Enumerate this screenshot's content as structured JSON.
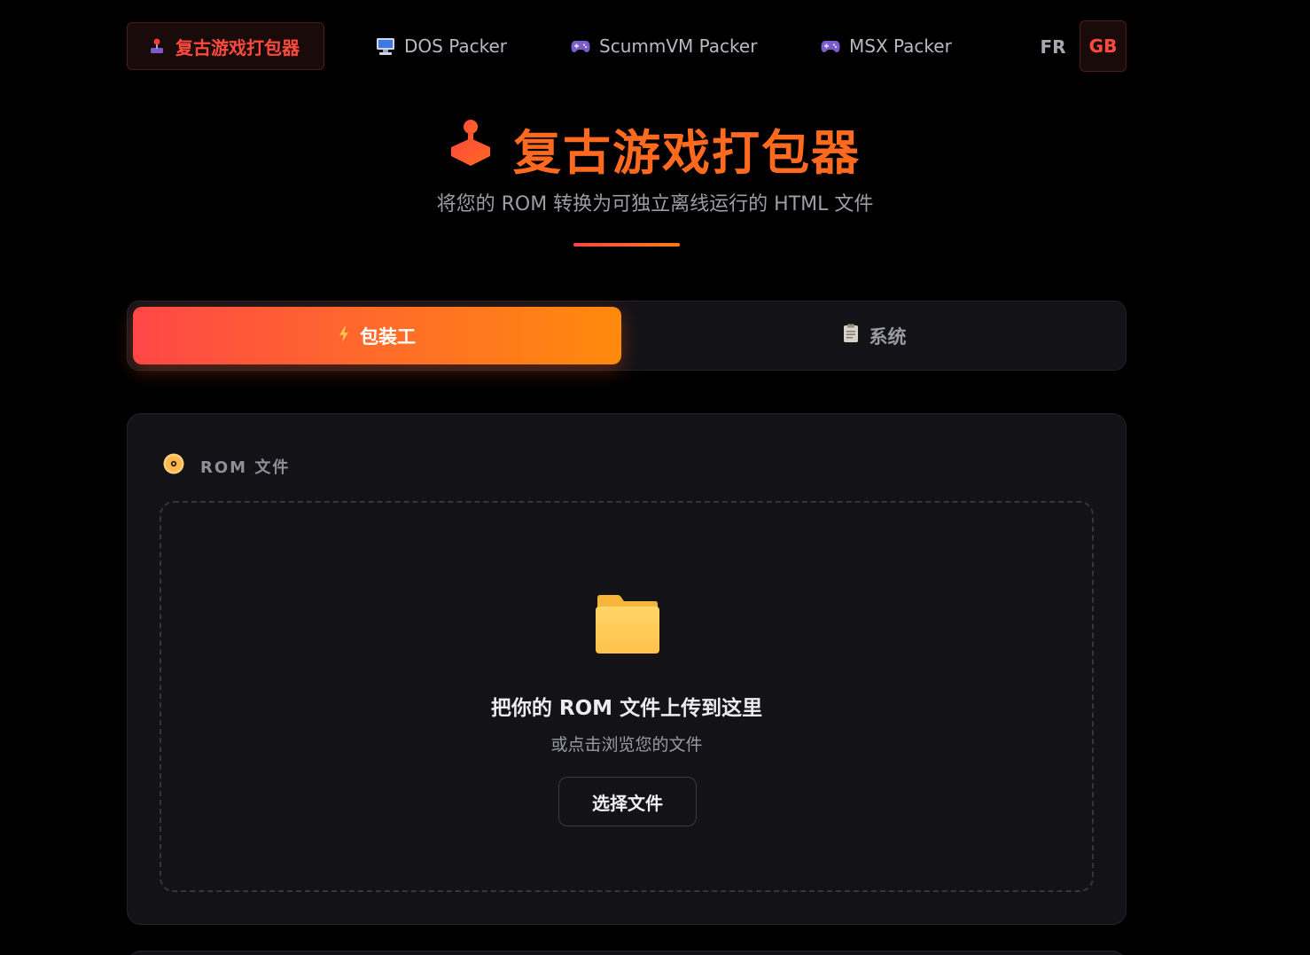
{
  "nav": {
    "items": [
      {
        "label": "复古游戏打包器",
        "icon": "joystick-icon",
        "active": true
      },
      {
        "label": "DOS Packer",
        "icon": "computer-icon",
        "active": false
      },
      {
        "label": "ScummVM Packer",
        "icon": "gamepad-icon",
        "active": false
      },
      {
        "label": "MSX Packer",
        "icon": "gamepad-icon",
        "active": false
      }
    ],
    "lang_fr": "FR",
    "lang_gb": "GB",
    "active_lang": "GB"
  },
  "header": {
    "title": "复古游戏打包器",
    "subtitle": "将您的 ROM 转换为可独立离线运行的 HTML 文件"
  },
  "tabs": [
    {
      "label": "包装工",
      "icon": "lightning-icon",
      "active": true
    },
    {
      "label": "系统",
      "icon": "clipboard-icon",
      "active": false
    }
  ],
  "rom_section": {
    "heading": "ROM 文件",
    "icon": "disc-icon",
    "dropzone": {
      "title": "把你的 ROM 文件上传到这里",
      "subtitle": "或点击浏览您的文件",
      "button": "选择文件",
      "icon": "folder-icon"
    }
  },
  "colors": {
    "accent_red": "#ff4a3d",
    "accent_orange": "#ff6a1f",
    "gradient_start": "#ff4747",
    "gradient_end": "#ff8a0c",
    "background": "#000000",
    "card": "#121217"
  }
}
